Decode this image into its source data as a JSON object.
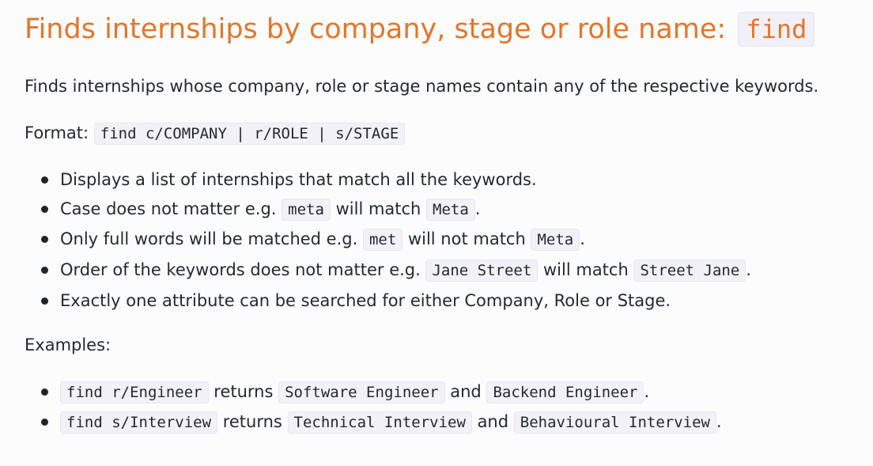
{
  "heading": {
    "text": "Finds internships by company, stage or role name: ",
    "command": "find"
  },
  "description": "Finds internships whose company, role or stage names contain any of the respective keywords.",
  "format": {
    "label": "Format: ",
    "syntax": "find c/COMPANY | r/ROLE | s/STAGE"
  },
  "notes": [
    {
      "parts": [
        {
          "t": "Displays a list of internships that match all the keywords."
        }
      ]
    },
    {
      "parts": [
        {
          "t": "Case does not matter e.g. "
        },
        {
          "c": "meta"
        },
        {
          "t": " will match "
        },
        {
          "c": "Meta"
        },
        {
          "t": "."
        }
      ]
    },
    {
      "parts": [
        {
          "t": "Only full words will be matched e.g. "
        },
        {
          "c": "met"
        },
        {
          "t": " will not match "
        },
        {
          "c": "Meta"
        },
        {
          "t": "."
        }
      ]
    },
    {
      "parts": [
        {
          "t": "Order of the keywords does not matter e.g. "
        },
        {
          "c": "Jane Street"
        },
        {
          "t": " will match "
        },
        {
          "c": "Street Jane"
        },
        {
          "t": "."
        }
      ]
    },
    {
      "parts": [
        {
          "t": "Exactly one attribute can be searched for either Company, Role or Stage."
        }
      ]
    }
  ],
  "examples_label": "Examples:",
  "examples": [
    {
      "parts": [
        {
          "c": "find r/Engineer"
        },
        {
          "t": " returns "
        },
        {
          "c": "Software Engineer"
        },
        {
          "t": " and "
        },
        {
          "c": "Backend Engineer"
        },
        {
          "t": "."
        }
      ]
    },
    {
      "parts": [
        {
          "c": "find s/Interview"
        },
        {
          "t": " returns "
        },
        {
          "c": "Technical Interview"
        },
        {
          "t": " and "
        },
        {
          "c": "Behavioural Interview"
        },
        {
          "t": "."
        }
      ]
    }
  ]
}
